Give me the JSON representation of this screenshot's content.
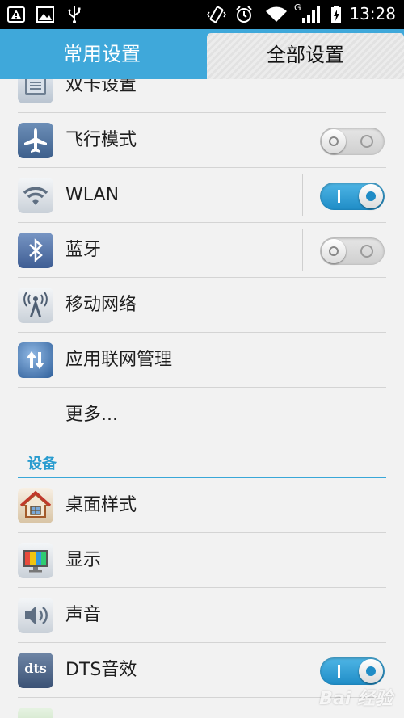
{
  "status_bar": {
    "time": "13:28",
    "network_label": "G"
  },
  "tabs": [
    {
      "label": "常用设置",
      "selected": false
    },
    {
      "label": "全部设置",
      "selected": true
    }
  ],
  "rows": [
    {
      "label": "双卡设置",
      "icon": "dual-sim-icon"
    },
    {
      "label": "飞行模式",
      "icon": "airplane-icon",
      "toggle": "off"
    },
    {
      "label": "WLAN",
      "icon": "wifi-icon",
      "toggle": "on"
    },
    {
      "label": "蓝牙",
      "icon": "bluetooth-icon",
      "toggle": "off"
    },
    {
      "label": "移动网络",
      "icon": "mobile-network-icon"
    },
    {
      "label": "应用联网管理",
      "icon": "network-manage-icon"
    },
    {
      "label": "更多..."
    }
  ],
  "section": {
    "title": "设备"
  },
  "device_rows": [
    {
      "label": "桌面样式",
      "icon": "home-icon"
    },
    {
      "label": "显示",
      "icon": "display-icon"
    },
    {
      "label": "声音",
      "icon": "speaker-icon"
    },
    {
      "label": "DTS音效",
      "icon": "dts-icon",
      "icon_text": "dts",
      "toggle": "on"
    }
  ],
  "watermark": "Bai 经验",
  "colors": {
    "accent": "#3fa8da",
    "toggle_on": "#1f8cc6",
    "section_title": "#2a9ccf"
  }
}
